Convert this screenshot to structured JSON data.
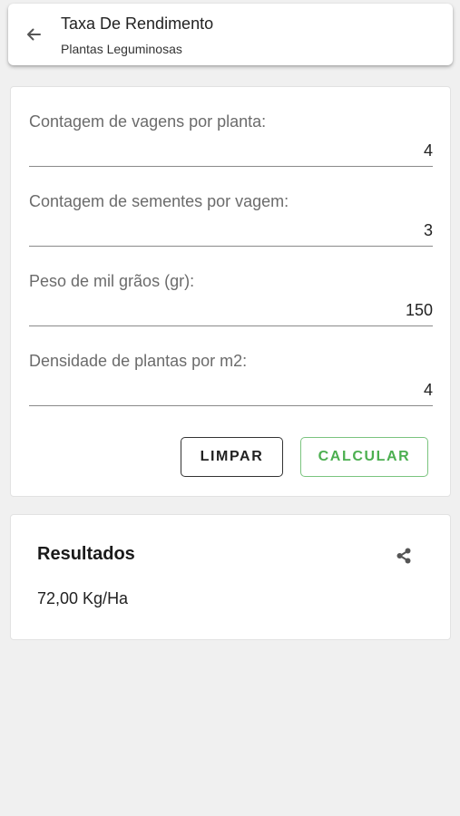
{
  "header": {
    "title": "Taxa De Rendimento",
    "subtitle": "Plantas Leguminosas",
    "back_icon": "arrow-left-icon"
  },
  "form": {
    "fields": [
      {
        "label": "Contagem de vagens por planta:",
        "value": "4"
      },
      {
        "label": "Contagem de sementes por vagem:",
        "value": "3"
      },
      {
        "label": "Peso de mil grãos (gr):",
        "value": "150"
      },
      {
        "label": "Densidade de plantas por m2:",
        "value": "4"
      }
    ],
    "clear_label": "LIMPAR",
    "calculate_label": "CALCULAR"
  },
  "results": {
    "title": "Resultados",
    "value": "72,00 Kg/Ha",
    "share_icon": "share-icon"
  },
  "colors": {
    "background": "#f0f0f0",
    "card": "#ffffff",
    "accent_green": "#4caf50"
  }
}
